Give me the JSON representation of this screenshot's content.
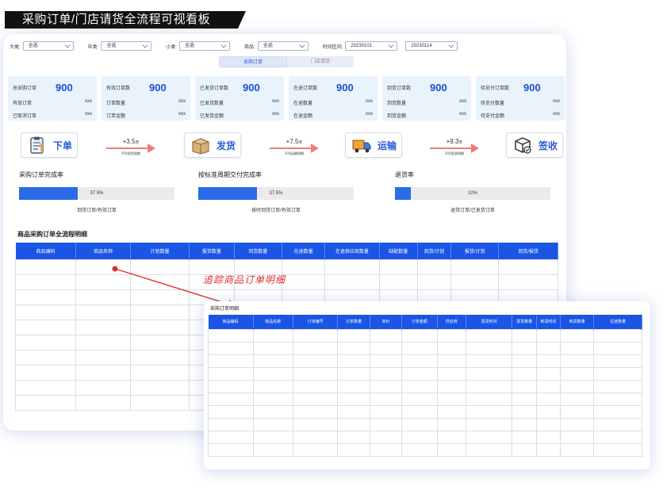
{
  "page_title": "采购订单/门店请货全流程可视看板",
  "filters": [
    {
      "label": "大类:",
      "value": "全选"
    },
    {
      "label": "中类:",
      "value": "全选"
    },
    {
      "label": "小类:",
      "value": "全选"
    },
    {
      "label": "商品:",
      "value": "全选"
    }
  ],
  "time_filter": {
    "label": "时间区间:",
    "start": "20230101",
    "end": "20230114"
  },
  "tabs": [
    {
      "label": "采购订单",
      "active": true
    },
    {
      "label": "门店请货",
      "active": false
    }
  ],
  "kpis": [
    {
      "title": "总采购订单",
      "value": "900",
      "rows": [
        {
          "label": "有效订单",
          "value": "xxx"
        },
        {
          "label": "已取消订单",
          "value": "xxx"
        }
      ]
    },
    {
      "title": "有效订单数",
      "value": "900",
      "rows": [
        {
          "label": "订单数量",
          "value": "xxx"
        },
        {
          "label": "订单金额",
          "value": "xxx"
        }
      ]
    },
    {
      "title": "已发货订单数",
      "value": "900",
      "rows": [
        {
          "label": "已发货数量",
          "value": "xxx"
        },
        {
          "label": "已发货金额",
          "value": "xxx"
        }
      ]
    },
    {
      "title": "在途订单数",
      "value": "900",
      "rows": [
        {
          "label": "在途数量",
          "value": "xxx"
        },
        {
          "label": "在途金额",
          "value": "xxx"
        }
      ]
    },
    {
      "title": "到货订单数",
      "value": "900",
      "rows": [
        {
          "label": "到货数量",
          "value": "xxx"
        },
        {
          "label": "到货金额",
          "value": "xxx"
        }
      ]
    },
    {
      "title": "待支付订单数",
      "value": "900",
      "rows": [
        {
          "label": "待支付数量",
          "value": "xxx"
        },
        {
          "label": "待支付金额",
          "value": "xxx"
        }
      ]
    }
  ],
  "flow": {
    "steps": [
      {
        "label": "下单",
        "icon": "clipboard-icon"
      },
      {
        "label": "发货",
        "icon": "box-icon"
      },
      {
        "label": "运输",
        "icon": "truck-icon"
      },
      {
        "label": "签收",
        "icon": "package-check-icon"
      }
    ],
    "arrows": [
      {
        "value": "+3.5",
        "unit": "天",
        "caption": "平均发货周期"
      },
      {
        "value": "+7.5",
        "unit": "天",
        "caption": "平均运输周期"
      },
      {
        "value": "+9.3",
        "unit": "天",
        "caption": "平均签收周期"
      }
    ]
  },
  "rates": [
    {
      "title": "采购订单完成率",
      "percent": 37.5,
      "percent_label": "37.5%",
      "caption": "到货订单/有效订单"
    },
    {
      "title": "按标准周期交付完成率",
      "percent": 37.5,
      "percent_label": "37.5%",
      "caption": "按时到货订单/有效订单"
    },
    {
      "title": "退货率",
      "percent": 10,
      "percent_label": "10%",
      "caption": "退货订单/已发货订单"
    }
  ],
  "main_table": {
    "title": "商品采购订单全流程明细",
    "columns": [
      "商品编码",
      "商品名称",
      "计划数量",
      "报货数量",
      "到货数量",
      "在途数量",
      "在途供应商数量",
      "缺配数量",
      "到货/计划",
      "报货/计划",
      "到货/报货"
    ]
  },
  "annotation": "追踪商品订单明细",
  "detail_table": {
    "title": "采购订单明细",
    "columns": [
      "商品编码",
      "商品名称",
      "订单编号",
      "订单数量",
      "单价",
      "订单金额",
      "供应商",
      "发货时间",
      "发货数量",
      "到货时间",
      "到货数量",
      "在途数量"
    ]
  },
  "colors": {
    "accent": "#1a55e6",
    "kpi_bg": "#e9f3fc",
    "arrow": "#f07a7a",
    "annotation": "#e0302a"
  }
}
